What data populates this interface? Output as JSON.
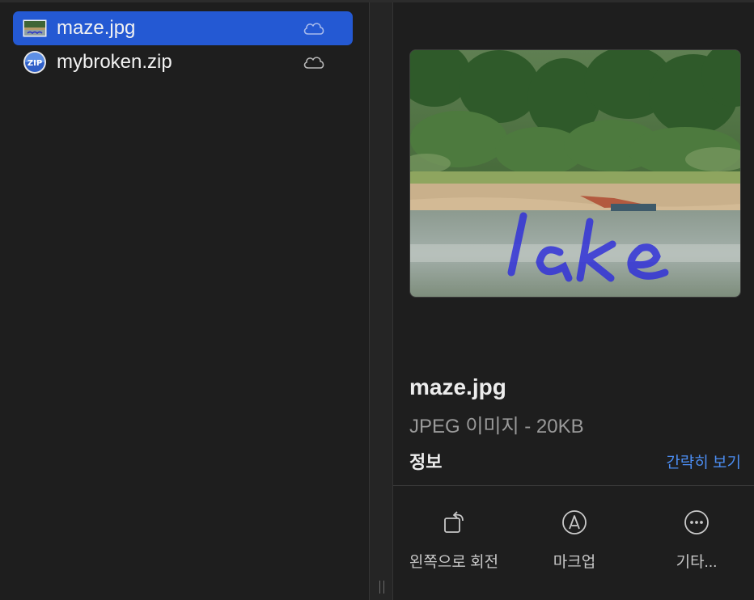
{
  "files": [
    {
      "name": "maze.jpg",
      "icon": "image-thumbnail-icon",
      "selected": true
    },
    {
      "name": "mybroken.zip",
      "icon": "zip-archive-icon",
      "selected": false
    }
  ],
  "inspector": {
    "file_name": "maze.jpg",
    "file_kind": "JPEG 이미지 - 20KB",
    "section_heading": "정보",
    "show_less_label": "간략히 보기"
  },
  "actions": [
    {
      "label": "왼쪽으로 회전",
      "icon": "rotate-left-icon"
    },
    {
      "label": "마크업",
      "icon": "markup-pen-icon"
    },
    {
      "label": "기타...",
      "icon": "more-ellipsis-icon"
    }
  ],
  "colors": {
    "selection": "#2459d3",
    "link": "#4b8cf0",
    "background": "#1e1e1e"
  }
}
